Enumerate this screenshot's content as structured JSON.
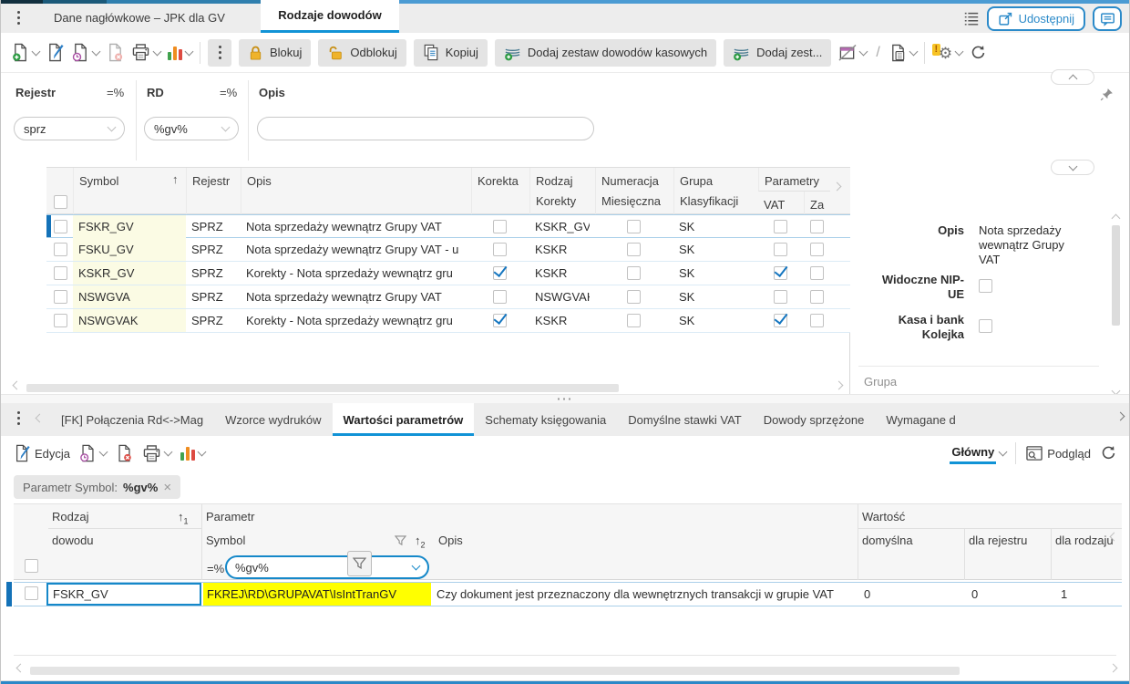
{
  "colors": {
    "accent": "#1588c9",
    "selection_bar": "#1472b8",
    "row_highlight": "#ffff00",
    "symbol_bg": "#fbfbe4",
    "tab_underline": "#1193d6"
  },
  "icons": [
    "kebab-icon",
    "new-document-icon",
    "edit-icon",
    "document-history-icon",
    "delete-document-icon",
    "print-icon",
    "chart-icon",
    "more-icon",
    "lock-icon",
    "unlock-icon",
    "copy-icon",
    "stack-add-icon",
    "send-icon",
    "calculator-icon",
    "gear-warning-icon",
    "refresh-icon",
    "share-icon",
    "chat-icon",
    "list-icon",
    "pin-icon",
    "funnel-icon",
    "preview-icon",
    "sort-asc-icon",
    "close-icon"
  ],
  "window": {
    "tab_inactive": "Dane nagłówkowe – JPK dla GV",
    "tab_active": "Rodzaje dowodów",
    "share_button": "Udostępnij"
  },
  "toolbar": {
    "blokuj": "Blokuj",
    "odblokuj": "Odblokuj",
    "kopiuj": "Kopiuj",
    "dodaj_kasowe": "Dodaj zestaw dowodów kasowych",
    "dodaj_zest": "Dodaj zest..."
  },
  "filter_panel": {
    "fields": [
      {
        "label": "Rejestr",
        "operator": "=%",
        "value": "sprz"
      },
      {
        "label": "RD",
        "operator": "=%",
        "value": "%gv%"
      },
      {
        "label": "Opis",
        "operator": "",
        "value": ""
      }
    ]
  },
  "main_table": {
    "headers": {
      "symbol": "Symbol",
      "rejestr": "Rejestr",
      "opis": "Opis",
      "korekta": "Korekta",
      "rodzaj_1": "Rodzaj",
      "rodzaj_2": "Korekty",
      "numeracja_1": "Numeracja",
      "numeracja_2": "Miesięczna",
      "grupa_1": "Grupa",
      "grupa_2": "Klasyfikacji",
      "parametry": "Parametry",
      "vat": "VAT",
      "za": "Za"
    },
    "rows": [
      {
        "symbol": "FSKR_GV",
        "rejestr": "SPRZ",
        "opis": "Nota sprzedaży wewnątrz Grupy VAT",
        "korekta": false,
        "rodzaj_korekty": "KSKR_GV",
        "numeracja_miesieczna": false,
        "grupa_klasyfikacji": "SK",
        "parametry_vat": false,
        "za": false
      },
      {
        "symbol": "FSKU_GV",
        "rejestr": "SPRZ",
        "opis": "Nota sprzedaży wewnątrz Grupy VAT - u",
        "korekta": false,
        "rodzaj_korekty": "KSKR",
        "numeracja_miesieczna": false,
        "grupa_klasyfikacji": "SK",
        "parametry_vat": false,
        "za": false
      },
      {
        "symbol": "KSKR_GV",
        "rejestr": "SPRZ",
        "opis": "Korekty - Nota sprzedaży wewnątrz gru",
        "korekta": true,
        "rodzaj_korekty": "KSKR",
        "numeracja_miesieczna": false,
        "grupa_klasyfikacji": "SK",
        "parametry_vat": true,
        "za": false
      },
      {
        "symbol": "NSWGVA",
        "rejestr": "SPRZ",
        "opis": "Nota sprzedaży wewnątrz Grupy VAT",
        "korekta": false,
        "rodzaj_korekty": "NSWGVAK",
        "numeracja_miesieczna": false,
        "grupa_klasyfikacji": "SK",
        "parametry_vat": false,
        "za": false
      },
      {
        "symbol": "NSWGVAK",
        "rejestr": "SPRZ",
        "opis": "Korekty - Nota sprzedaży wewnątrz gru",
        "korekta": true,
        "rodzaj_korekty": "KSKR",
        "numeracja_miesieczna": false,
        "grupa_klasyfikacji": "SK",
        "parametry_vat": true,
        "za": false
      }
    ]
  },
  "detail_panel": {
    "opis_label": "Opis",
    "opis_value": "Nota sprzedaży wewnątrz Grupy VAT",
    "nip_label_line1": "Widoczne NIP-",
    "nip_label_line2": "UE",
    "nip_checked": false,
    "kasa_label_line1": "Kasa i bank",
    "kasa_label_line2": "Kolejka",
    "kasa_checked": false,
    "grupa_section": "Grupa"
  },
  "bottom_tabs": [
    "[FK] Połączenia Rd<->Mag",
    "Wzorce wydruków",
    "Wartości parametrów",
    "Schematy księgowania",
    "Domyślne stawki VAT",
    "Dowody sprzężone",
    "Wymagane d"
  ],
  "bottom_toolbar": {
    "edycja": "Edycja",
    "glowny": "Główny",
    "podglad": "Podgląd"
  },
  "filter_chip": {
    "label": "Parametr Symbol:",
    "value": "%gv%"
  },
  "bottom_table": {
    "headers": {
      "rodzaj_1": "Rodzaj",
      "rodzaj_2": "dowodu",
      "parametr_1": "Parametr",
      "parametr_2": "Symbol",
      "opis": "Opis",
      "wartosc": "Wartość",
      "domyslna": "domyślna",
      "dla_rejestru": "dla rejestru",
      "dla_rodzaju": "dla rodzaju"
    },
    "filter": {
      "operator": "=%",
      "value": "%gv%"
    },
    "rows": [
      {
        "rodzaj_dowodu": "FSKR_GV",
        "parametr_symbol": "FKREJ\\RD\\GRUPAVAT\\IsIntTranGV",
        "opis": "Czy dokument jest przeznaczony dla wewnętrznych transakcji w grupie VAT",
        "domyslna": "0",
        "dla_rejestru": "0",
        "dla_rodzaju": "1"
      }
    ]
  }
}
